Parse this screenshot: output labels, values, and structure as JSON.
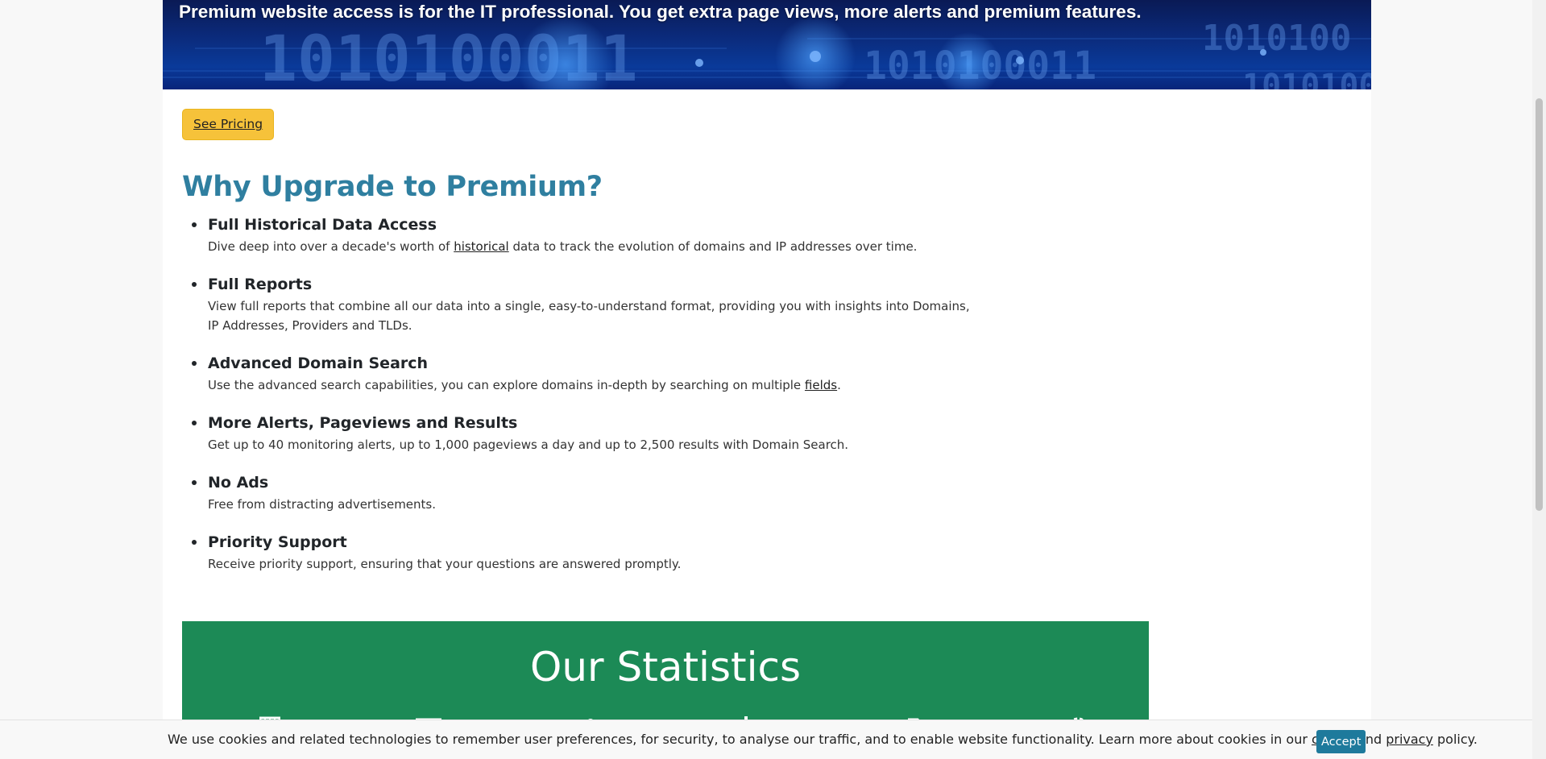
{
  "hero": {
    "text": "Premium website access is for the IT professional. You get extra page views, more alerts and premium features."
  },
  "pricing_button": "See Pricing",
  "heading": "Why Upgrade to Premium?",
  "features": [
    {
      "title": "Full Historical Data Access",
      "desc_before": "Dive deep into over a decade's worth of ",
      "link": "historical",
      "desc_after": " data to track the evolution of domains and IP addresses over time."
    },
    {
      "title": "Full Reports",
      "desc_before": "View full reports that combine all our data into a single, easy-to-understand format, providing you with insights into Domains, IP Addresses, Providers and TLDs.",
      "link": "",
      "desc_after": ""
    },
    {
      "title": "Advanced Domain Search",
      "desc_before": "Use the advanced search capabilities, you can explore domains in-depth by searching on multiple ",
      "link": "fields",
      "desc_after": "."
    },
    {
      "title": "More Alerts, Pageviews and Results",
      "desc_before": "Get up to 40 monitoring alerts, up to 1,000 pageviews a day and up to 2,500 results with Domain Search.",
      "link": "",
      "desc_after": ""
    },
    {
      "title": "No Ads",
      "desc_before": "Free from distracting advertisements.",
      "link": "",
      "desc_after": ""
    },
    {
      "title": "Priority Support",
      "desc_before": "Receive priority support, ensuring that your questions are answered promptly.",
      "link": "",
      "desc_after": ""
    }
  ],
  "stats": {
    "title": "Our Statistics",
    "icons": [
      "server-icon",
      "monitor-icon",
      "user-icon",
      "bar-chart-icon",
      "document-icon",
      "clock-icon"
    ]
  },
  "cookie": {
    "text_before": "We use cookies and related technologies to remember user preferences, for security, to analyse our traffic, and to enable website functionality. Learn more about cookies in our ",
    "cookie_link": "cookie",
    "and_text": " and ",
    "privacy_link": "privacy",
    "text_after": " policy.",
    "accept_label": "Accept"
  },
  "colors": {
    "accent_heading": "#2f7fa0",
    "button_yellow": "#f6c23a",
    "stats_green": "#1c8a56",
    "accept_blue": "#1e7a9c"
  }
}
